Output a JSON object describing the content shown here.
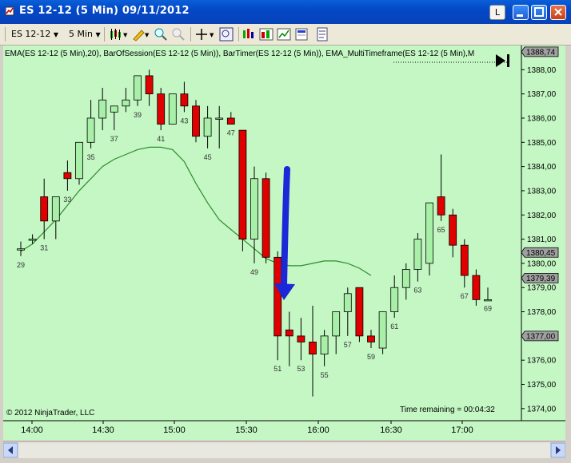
{
  "window": {
    "title": "ES 12-12 (5 Min)  09/11/2012",
    "l_button": "L"
  },
  "toolbar": {
    "instrument": "ES 12-12",
    "interval": "5 Min"
  },
  "chart": {
    "indicators_label": "EMA(ES 12-12 (5 Min),20), BarOfSession(ES 12-12 (5 Min)), BarTimer(ES 12-12 (5 Min)), EMA_MultiTimeframe(ES 12-12 (5 Min),M",
    "copyright": "© 2012 NinjaTrader, LLC",
    "time_remaining": "Time remaining = 00:04:32",
    "colors": {
      "background": "#c4f7c4",
      "up_bar": "#a8f0a8",
      "down_bar": "#e00000",
      "ema": "#2e8b2e",
      "ema_mtf": "#22bb22",
      "arrow": "#1a28d8"
    }
  },
  "chart_data": {
    "type": "candlestick",
    "ylim": [
      1373.5,
      1389.0
    ],
    "y_ticks": [
      "1388,00",
      "1387,00",
      "1386,00",
      "1385,00",
      "1384,00",
      "1383,00",
      "1382,00",
      "1381,00",
      "1380,00",
      "1379,00",
      "1378,00",
      "1377,00",
      "1376,00",
      "1375,00",
      "1374,00"
    ],
    "x_ticks": [
      "14:00",
      "14:30",
      "15:00",
      "15:30",
      "16:00",
      "16:30",
      "17:00"
    ],
    "price_markers": [
      {
        "label": "1388,74",
        "value": 1388.74
      },
      {
        "label": "1380,45",
        "value": 1380.45
      },
      {
        "label": "1379,39",
        "value": 1379.39
      },
      {
        "label": "1377,00",
        "value": 1377.0
      }
    ],
    "bar_labels": [
      {
        "label": "29",
        "bar": 0
      },
      {
        "label": "31",
        "bar": 2
      },
      {
        "label": "33",
        "bar": 4
      },
      {
        "label": "35",
        "bar": 6
      },
      {
        "label": "37",
        "bar": 8
      },
      {
        "label": "39",
        "bar": 10
      },
      {
        "label": "41",
        "bar": 12
      },
      {
        "label": "43",
        "bar": 14
      },
      {
        "label": "45",
        "bar": 16
      },
      {
        "label": "47",
        "bar": 18
      },
      {
        "label": "49",
        "bar": 20
      },
      {
        "label": "51",
        "bar": 22
      },
      {
        "label": "53",
        "bar": 24
      },
      {
        "label": "55",
        "bar": 26
      },
      {
        "label": "57",
        "bar": 28
      },
      {
        "label": "59",
        "bar": 30
      },
      {
        "label": "61",
        "bar": 32
      },
      {
        "label": "63",
        "bar": 34
      },
      {
        "label": "65",
        "bar": 36
      },
      {
        "label": "67",
        "bar": 38
      },
      {
        "label": "69",
        "bar": 40
      }
    ],
    "bars": [
      {
        "o": 1380.6,
        "h": 1380.9,
        "l": 1380.3,
        "c": 1380.6
      },
      {
        "o": 1381.0,
        "h": 1381.2,
        "l": 1380.8,
        "c": 1381.0
      },
      {
        "o": 1382.75,
        "h": 1383.5,
        "l": 1381.0,
        "c": 1381.75
      },
      {
        "o": 1381.75,
        "h": 1382.75,
        "l": 1381.0,
        "c": 1382.75
      },
      {
        "o": 1383.75,
        "h": 1384.25,
        "l": 1383.0,
        "c": 1383.5
      },
      {
        "o": 1383.5,
        "h": 1385.0,
        "l": 1383.25,
        "c": 1385.0
      },
      {
        "o": 1385.0,
        "h": 1386.75,
        "l": 1384.75,
        "c": 1386.0
      },
      {
        "o": 1386.0,
        "h": 1387.25,
        "l": 1385.5,
        "c": 1386.75
      },
      {
        "o": 1386.25,
        "h": 1386.5,
        "l": 1385.5,
        "c": 1386.5
      },
      {
        "o": 1386.5,
        "h": 1387.25,
        "l": 1386.25,
        "c": 1386.75
      },
      {
        "o": 1386.75,
        "h": 1387.75,
        "l": 1386.5,
        "c": 1387.75
      },
      {
        "o": 1387.75,
        "h": 1388.0,
        "l": 1386.5,
        "c": 1387.0
      },
      {
        "o": 1387.0,
        "h": 1387.25,
        "l": 1385.5,
        "c": 1385.75
      },
      {
        "o": 1385.75,
        "h": 1387.0,
        "l": 1385.75,
        "c": 1387.0
      },
      {
        "o": 1387.0,
        "h": 1387.5,
        "l": 1386.25,
        "c": 1386.5
      },
      {
        "o": 1386.5,
        "h": 1386.75,
        "l": 1385.0,
        "c": 1385.25
      },
      {
        "o": 1385.25,
        "h": 1386.5,
        "l": 1384.75,
        "c": 1386.0
      },
      {
        "o": 1386.0,
        "h": 1386.5,
        "l": 1384.75,
        "c": 1386.0
      },
      {
        "o": 1386.0,
        "h": 1386.25,
        "l": 1385.75,
        "c": 1385.75
      },
      {
        "o": 1385.5,
        "h": 1385.5,
        "l": 1380.5,
        "c": 1381.0
      },
      {
        "o": 1381.0,
        "h": 1384.0,
        "l": 1380.0,
        "c": 1383.5
      },
      {
        "o": 1383.5,
        "h": 1383.75,
        "l": 1380.0,
        "c": 1380.25
      },
      {
        "o": 1380.25,
        "h": 1380.5,
        "l": 1376.0,
        "c": 1377.0
      },
      {
        "o": 1377.25,
        "h": 1378.0,
        "l": 1375.75,
        "c": 1377.0
      },
      {
        "o": 1377.0,
        "h": 1377.75,
        "l": 1376.0,
        "c": 1376.75
      },
      {
        "o": 1376.75,
        "h": 1378.25,
        "l": 1374.5,
        "c": 1376.25
      },
      {
        "o": 1376.25,
        "h": 1377.25,
        "l": 1375.75,
        "c": 1377.0
      },
      {
        "o": 1377.0,
        "h": 1378.0,
        "l": 1376.25,
        "c": 1378.0
      },
      {
        "o": 1378.0,
        "h": 1379.0,
        "l": 1377.0,
        "c": 1378.75
      },
      {
        "o": 1379.0,
        "h": 1379.0,
        "l": 1376.75,
        "c": 1377.0
      },
      {
        "o": 1377.0,
        "h": 1377.25,
        "l": 1376.5,
        "c": 1376.75
      },
      {
        "o": 1376.5,
        "h": 1378.0,
        "l": 1376.25,
        "c": 1378.0
      },
      {
        "o": 1378.0,
        "h": 1379.5,
        "l": 1377.75,
        "c": 1379.0
      },
      {
        "o": 1379.0,
        "h": 1380.0,
        "l": 1378.5,
        "c": 1379.75
      },
      {
        "o": 1379.75,
        "h": 1381.25,
        "l": 1379.25,
        "c": 1381.0
      },
      {
        "o": 1380.0,
        "h": 1382.5,
        "l": 1379.5,
        "c": 1382.5
      },
      {
        "o": 1382.75,
        "h": 1384.5,
        "l": 1381.75,
        "c": 1382.0
      },
      {
        "o": 1382.0,
        "h": 1382.25,
        "l": 1380.25,
        "c": 1380.75
      },
      {
        "o": 1380.75,
        "h": 1381.0,
        "l": 1379.0,
        "c": 1379.5
      },
      {
        "o": 1379.5,
        "h": 1379.75,
        "l": 1378.25,
        "c": 1378.5
      },
      {
        "o": 1378.5,
        "h": 1379.0,
        "l": 1378.5,
        "c": 1378.5
      }
    ],
    "ema": [
      1380.5,
      1380.8,
      1381.3,
      1381.8,
      1382.4,
      1383.0,
      1383.5,
      1384.0,
      1384.3,
      1384.5,
      1384.7,
      1384.8,
      1384.8,
      1384.7,
      1384.2,
      1383.3,
      1382.5,
      1381.8,
      1381.4,
      1381.0,
      1380.6,
      1380.2,
      1380.0,
      1379.9,
      1379.9,
      1380.0,
      1380.1,
      1380.1,
      1380.0,
      1379.8,
      1379.5
    ]
  }
}
